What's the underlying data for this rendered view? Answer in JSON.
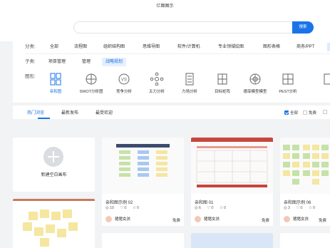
{
  "app": {
    "title": "亿图图示"
  },
  "search": {
    "placeholder": "",
    "button": "搜索"
  },
  "filters": {
    "category": {
      "label": "分类:",
      "options": [
        "全部",
        "流程图",
        "组织结构图",
        "思维导图",
        "软件/计算机",
        "专业领域绘图",
        "图形表格",
        "商务/PPT"
      ]
    },
    "subcategory": {
      "label": "子类:",
      "options": [
        "项目管理",
        "管理",
        "战略规划"
      ],
      "selected": "战略规划"
    },
    "shape": {
      "label": "图形:",
      "options": [
        "亲和图",
        "SWOT分析图",
        "竞争分析",
        "五力分析",
        "力场分析",
        "目标矩阵",
        "德菲模型模型",
        "PEST分析"
      ],
      "selected": "亲和图"
    }
  },
  "tabs": {
    "items": [
      "热门浏览",
      "最新发布",
      "最受欢迎"
    ],
    "selected": "热门浏览"
  },
  "checks": {
    "all": "全部",
    "free": "免费",
    "all_checked": true
  },
  "new_blank": "新建空白画布",
  "cards": [
    {
      "name": "亲和图示例 02",
      "views": "10",
      "likes": "0",
      "favs": "0",
      "author": "猪猪女孩",
      "price": "免费"
    },
    {
      "name": "亲和图 01",
      "views": "6",
      "likes": "0",
      "favs": "0",
      "author": "猪猪女孩",
      "price": "免费"
    },
    {
      "name": "亲和图示例 06",
      "views": "3",
      "likes": "0",
      "favs": "0",
      "author": "猪猪女孩",
      "price": "免费"
    }
  ],
  "colors": {
    "accent": "#1a73e8",
    "yellow_note": "#f5e6a0",
    "green_block": "#c6e2a8",
    "red_header": "#c8463c"
  },
  "icons": [
    "affinity-icon",
    "swot-icon",
    "vs-icon",
    "five-force-icon",
    "force-field-icon",
    "target-matrix-icon",
    "delphi-icon",
    "pest-icon"
  ]
}
